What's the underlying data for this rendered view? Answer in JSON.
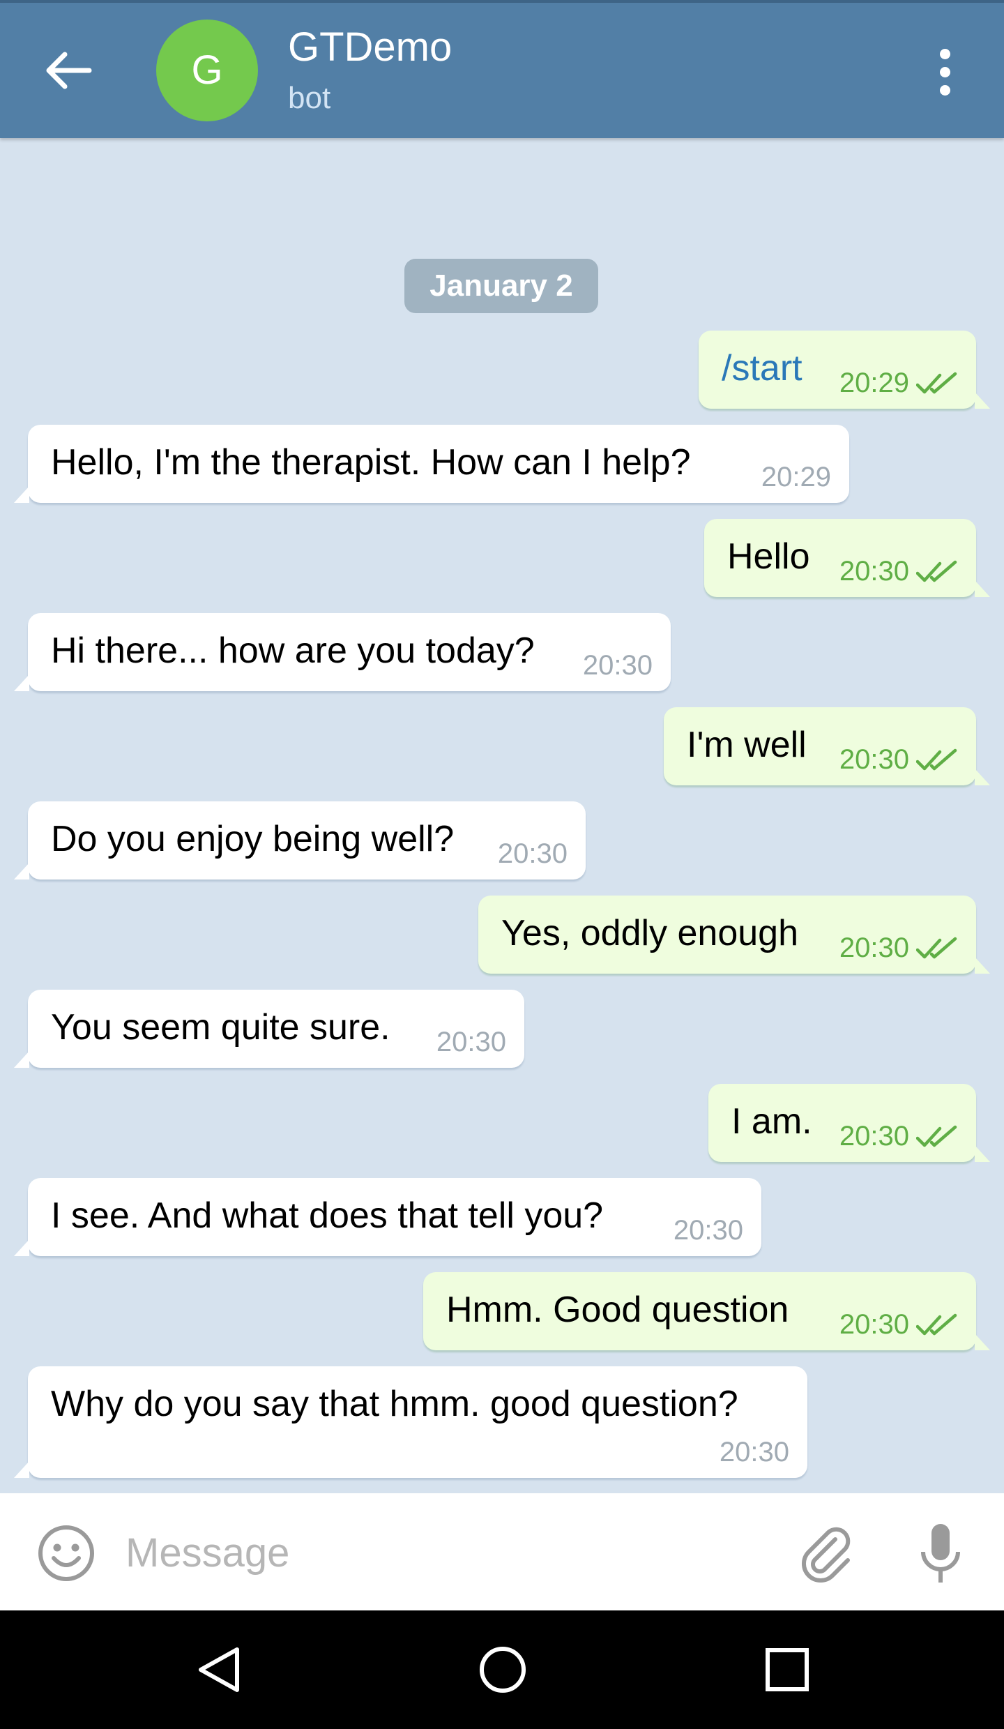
{
  "header": {
    "title": "GTDemo",
    "subtitle": "bot",
    "avatar_letter": "G",
    "avatar_color": "#74c94d",
    "bar_color": "#527fa6",
    "back_icon": "arrow-back-icon",
    "menu_icon": "more-vertical-icon"
  },
  "date_label": "January 2",
  "messages": [
    {
      "dir": "out",
      "text": "/start",
      "time": "20:29",
      "read": true,
      "is_command": true
    },
    {
      "dir": "in",
      "text": "Hello, I'm the therapist.  How can I help?",
      "time": "20:29"
    },
    {
      "dir": "out",
      "text": "Hello",
      "time": "20:30",
      "read": true
    },
    {
      "dir": "in",
      "text": "Hi there... how are you today?",
      "time": "20:30"
    },
    {
      "dir": "out",
      "text": "I'm well",
      "time": "20:30",
      "read": true
    },
    {
      "dir": "in",
      "text": "Do you enjoy being well?",
      "time": "20:30"
    },
    {
      "dir": "out",
      "text": "Yes, oddly enough",
      "time": "20:30",
      "read": true
    },
    {
      "dir": "in",
      "text": "You seem quite sure.",
      "time": "20:30"
    },
    {
      "dir": "out",
      "text": "I am.",
      "time": "20:30",
      "read": true
    },
    {
      "dir": "in",
      "text": "I see.  And what does that tell you?",
      "time": "20:30"
    },
    {
      "dir": "out",
      "text": "Hmm. Good question",
      "time": "20:30",
      "read": true
    },
    {
      "dir": "in",
      "text": "Why do you say that hmm. good question?",
      "time": "20:30"
    }
  ],
  "composer": {
    "placeholder": "Message",
    "value": "",
    "emoji_icon": "emoji-smile-icon",
    "attach_icon": "paperclip-icon",
    "mic_icon": "microphone-icon"
  },
  "colors": {
    "chat_background": "#d6e2ee",
    "incoming_bubble": "#ffffff",
    "outgoing_bubble": "#effdde",
    "outgoing_time": "#5fae45",
    "incoming_time": "#a0aab3",
    "command_link": "#2a78b8"
  },
  "navbar": {
    "back_icon": "nav-back-triangle-icon",
    "home_icon": "nav-home-circle-icon",
    "recent_icon": "nav-recent-square-icon"
  }
}
